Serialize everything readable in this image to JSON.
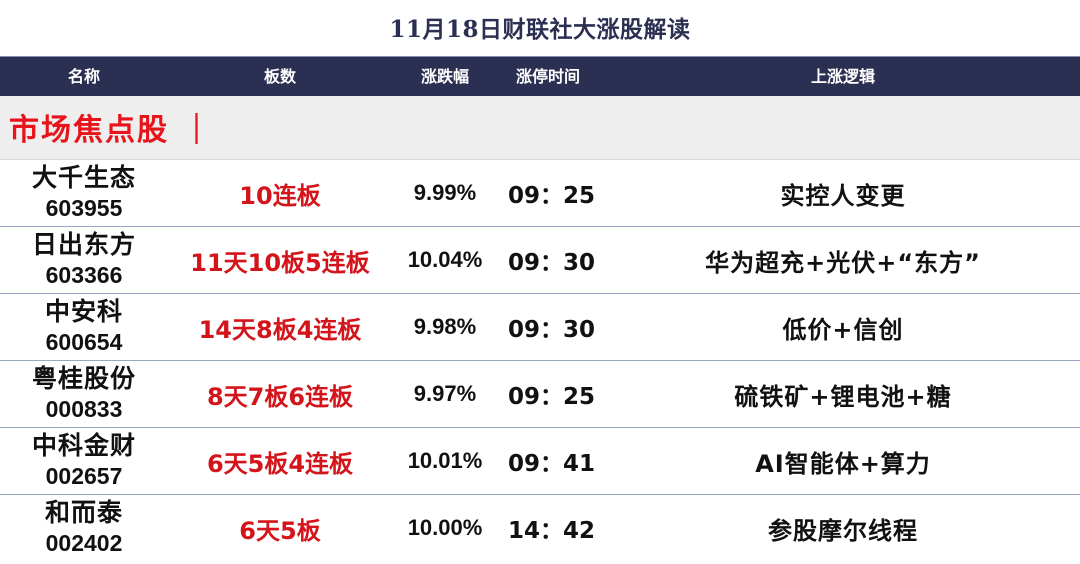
{
  "page": {
    "title": "11月18日财联社大涨股解读"
  },
  "table": {
    "headers": {
      "name": "名称",
      "board": "板数",
      "change": "涨跌幅",
      "limit_time": "涨停时间",
      "logic": "上涨逻辑"
    },
    "section_title": "市场焦点股 ｜",
    "rows": [
      {
        "name": "大千生态",
        "code": "603955",
        "board": "10连板",
        "change": "9.99%",
        "limit_time": "09：25",
        "logic": "实控人变更"
      },
      {
        "name": "日出东方",
        "code": "603366",
        "board": "11天10板5连板",
        "change": "10.04%",
        "limit_time": "09：30",
        "logic": "华为超充+光伏+“东方”"
      },
      {
        "name": "中安科",
        "code": "600654",
        "board": "14天8板4连板",
        "change": "9.98%",
        "limit_time": "09：30",
        "logic": "低价+信创"
      },
      {
        "name": "粤桂股份",
        "code": "000833",
        "board": "8天7板6连板",
        "change": "9.97%",
        "limit_time": "09：25",
        "logic": "硫铁矿+锂电池+糖"
      },
      {
        "name": "中科金财",
        "code": "002657",
        "board": "6天5板4连板",
        "change": "10.01%",
        "limit_time": "09：41",
        "logic": "AI智能体+算力"
      },
      {
        "name": "和而泰",
        "code": "002402",
        "board": "6天5板",
        "change": "10.00%",
        "limit_time": "14：42",
        "logic": "参股摩尔线程"
      }
    ]
  },
  "colors": {
    "header_bg": "#2b2f52",
    "highlight_red": "#d4141b",
    "section_bg": "#eeeeee"
  }
}
